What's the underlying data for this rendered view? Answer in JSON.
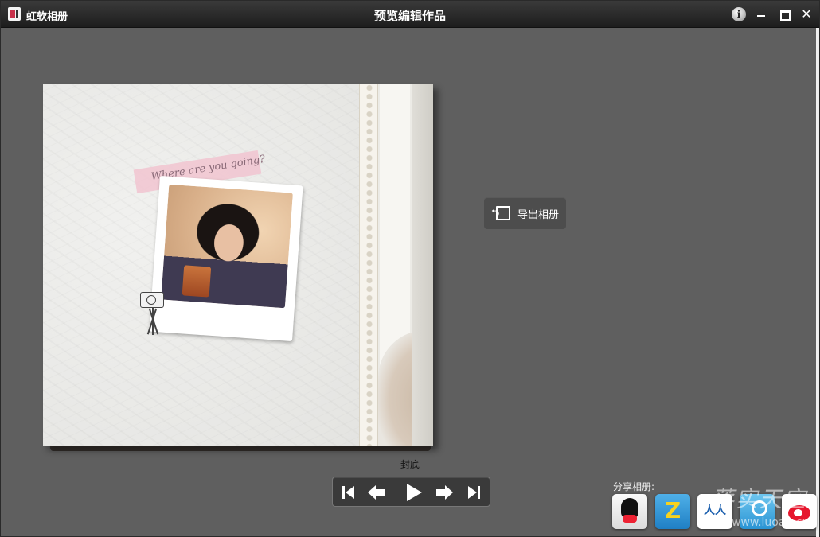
{
  "window": {
    "app_name": "虹软相册",
    "title": "预览编辑作品",
    "info_glyph": "i",
    "close_glyph": "✕"
  },
  "album": {
    "ribbon_text": "Where are you going?",
    "page_label": "封底"
  },
  "actions": {
    "export_label": "导出相册"
  },
  "share": {
    "label": "分享相册:",
    "services": [
      "qq",
      "qzone",
      "renren",
      "tencent-weibo",
      "sina-weibo"
    ]
  },
  "watermark": {
    "logo_text": "落实天空",
    "url": "www.luoan.cn"
  }
}
